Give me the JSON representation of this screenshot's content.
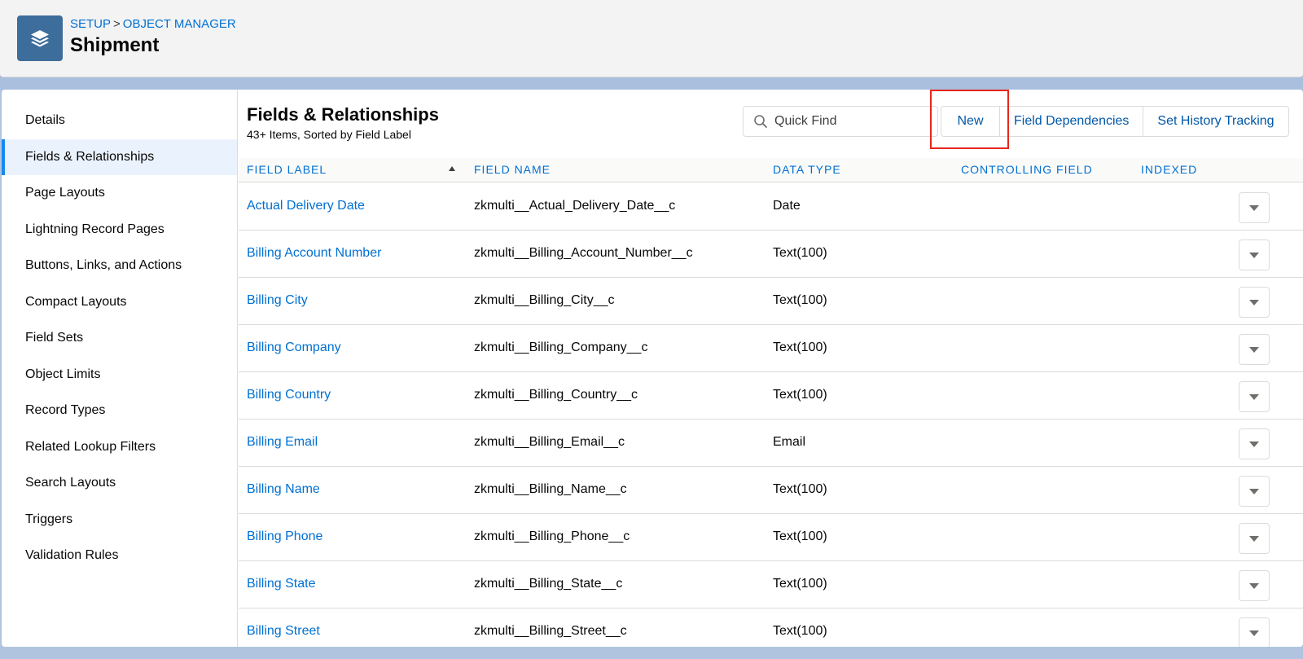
{
  "header": {
    "breadcrumb": [
      "SETUP",
      "OBJECT MANAGER"
    ],
    "breadcrumb_separator": ">",
    "title": "Shipment",
    "icon": "layers-icon"
  },
  "sidebar": {
    "items": [
      {
        "label": "Details",
        "active": false
      },
      {
        "label": "Fields & Relationships",
        "active": true
      },
      {
        "label": "Page Layouts",
        "active": false
      },
      {
        "label": "Lightning Record Pages",
        "active": false
      },
      {
        "label": "Buttons, Links, and Actions",
        "active": false
      },
      {
        "label": "Compact Layouts",
        "active": false
      },
      {
        "label": "Field Sets",
        "active": false
      },
      {
        "label": "Object Limits",
        "active": false
      },
      {
        "label": "Record Types",
        "active": false
      },
      {
        "label": "Related Lookup Filters",
        "active": false
      },
      {
        "label": "Search Layouts",
        "active": false
      },
      {
        "label": "Triggers",
        "active": false
      },
      {
        "label": "Validation Rules",
        "active": false
      }
    ]
  },
  "main": {
    "title": "Fields & Relationships",
    "subtitle": "43+ Items, Sorted by Field Label",
    "search": {
      "placeholder": "Quick Find",
      "value": ""
    },
    "buttons": {
      "new": "New",
      "field_dependencies": "Field Dependencies",
      "set_history_tracking": "Set History Tracking"
    },
    "columns": {
      "field_label": "FIELD LABEL",
      "field_name": "FIELD NAME",
      "data_type": "DATA TYPE",
      "controlling_field": "CONTROLLING FIELD",
      "indexed": "INDEXED"
    },
    "sort": {
      "column": "field_label",
      "direction": "ascending"
    },
    "rows": [
      {
        "label": "Actual Delivery Date",
        "name": "zkmulti__Actual_Delivery_Date__c",
        "type": "Date"
      },
      {
        "label": "Billing Account Number",
        "name": "zkmulti__Billing_Account_Number__c",
        "type": "Text(100)"
      },
      {
        "label": "Billing City",
        "name": "zkmulti__Billing_City__c",
        "type": "Text(100)"
      },
      {
        "label": "Billing Company",
        "name": "zkmulti__Billing_Company__c",
        "type": "Text(100)"
      },
      {
        "label": "Billing Country",
        "name": "zkmulti__Billing_Country__c",
        "type": "Text(100)"
      },
      {
        "label": "Billing Email",
        "name": "zkmulti__Billing_Email__c",
        "type": "Email"
      },
      {
        "label": "Billing Name",
        "name": "zkmulti__Billing_Name__c",
        "type": "Text(100)"
      },
      {
        "label": "Billing Phone",
        "name": "zkmulti__Billing_Phone__c",
        "type": "Text(100)"
      },
      {
        "label": "Billing State",
        "name": "zkmulti__Billing_State__c",
        "type": "Text(100)"
      },
      {
        "label": "Billing Street",
        "name": "zkmulti__Billing_Street__c",
        "type": "Text(100)"
      }
    ]
  },
  "colors": {
    "link": "#0070d2",
    "icon_bg": "#3d6d9b",
    "highlight": "#e8261c",
    "active_bg": "#eaf3fd"
  }
}
